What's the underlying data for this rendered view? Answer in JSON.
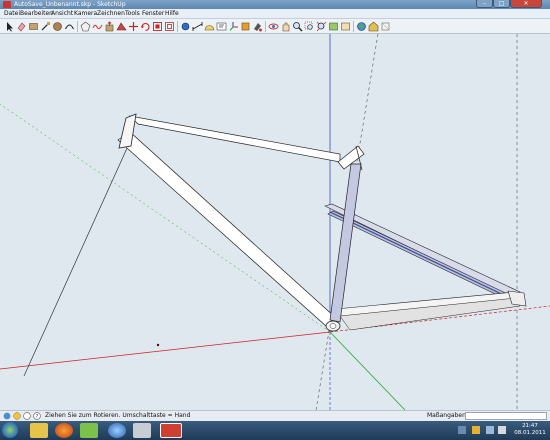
{
  "window": {
    "title": "AutoSave_Unbenannt.skp - SketchUp",
    "buttons": {
      "minimize": "–",
      "maximize": "□",
      "close": "✕"
    }
  },
  "menubar": {
    "items": [
      "Datei",
      "Bearbeiten",
      "Ansicht",
      "Kamera",
      "Zeichnen",
      "Tools",
      "Fenster",
      "Hilfe"
    ]
  },
  "toolbar": {
    "tools": [
      "select-icon",
      "eraser-icon",
      "rectangle-icon",
      "line-icon",
      "circle-icon",
      "arc-icon",
      "polygon-icon",
      "freehand-icon",
      "pushpull-icon",
      "followme-icon",
      "move-icon",
      "rotate-icon",
      "scale-icon",
      "offset-icon",
      "tape-icon",
      "dimension-icon",
      "protractor-icon",
      "text-icon",
      "axes-icon",
      "section-icon",
      "paint-icon",
      "orbit-icon",
      "pan-icon",
      "zoom-icon",
      "zoom-window-icon",
      "zoom-extents-icon",
      "previous-view-icon",
      "next-view-icon",
      "geo-location-icon",
      "warehouse-icon",
      "components-icon"
    ]
  },
  "statusbar": {
    "hint": "Ziehen Sie zum Rotieren.  Umschalttaste = Hand",
    "measure_label": "Maßangaben",
    "measure_value": ""
  },
  "taskbar": {
    "time": "21:47",
    "date": "08.01.2011"
  },
  "colors": {
    "x_axis": "#cc2222",
    "y_axis": "#22aa22",
    "z_axis": "#3355cc",
    "viewport_bg": "#dfe7ef"
  }
}
